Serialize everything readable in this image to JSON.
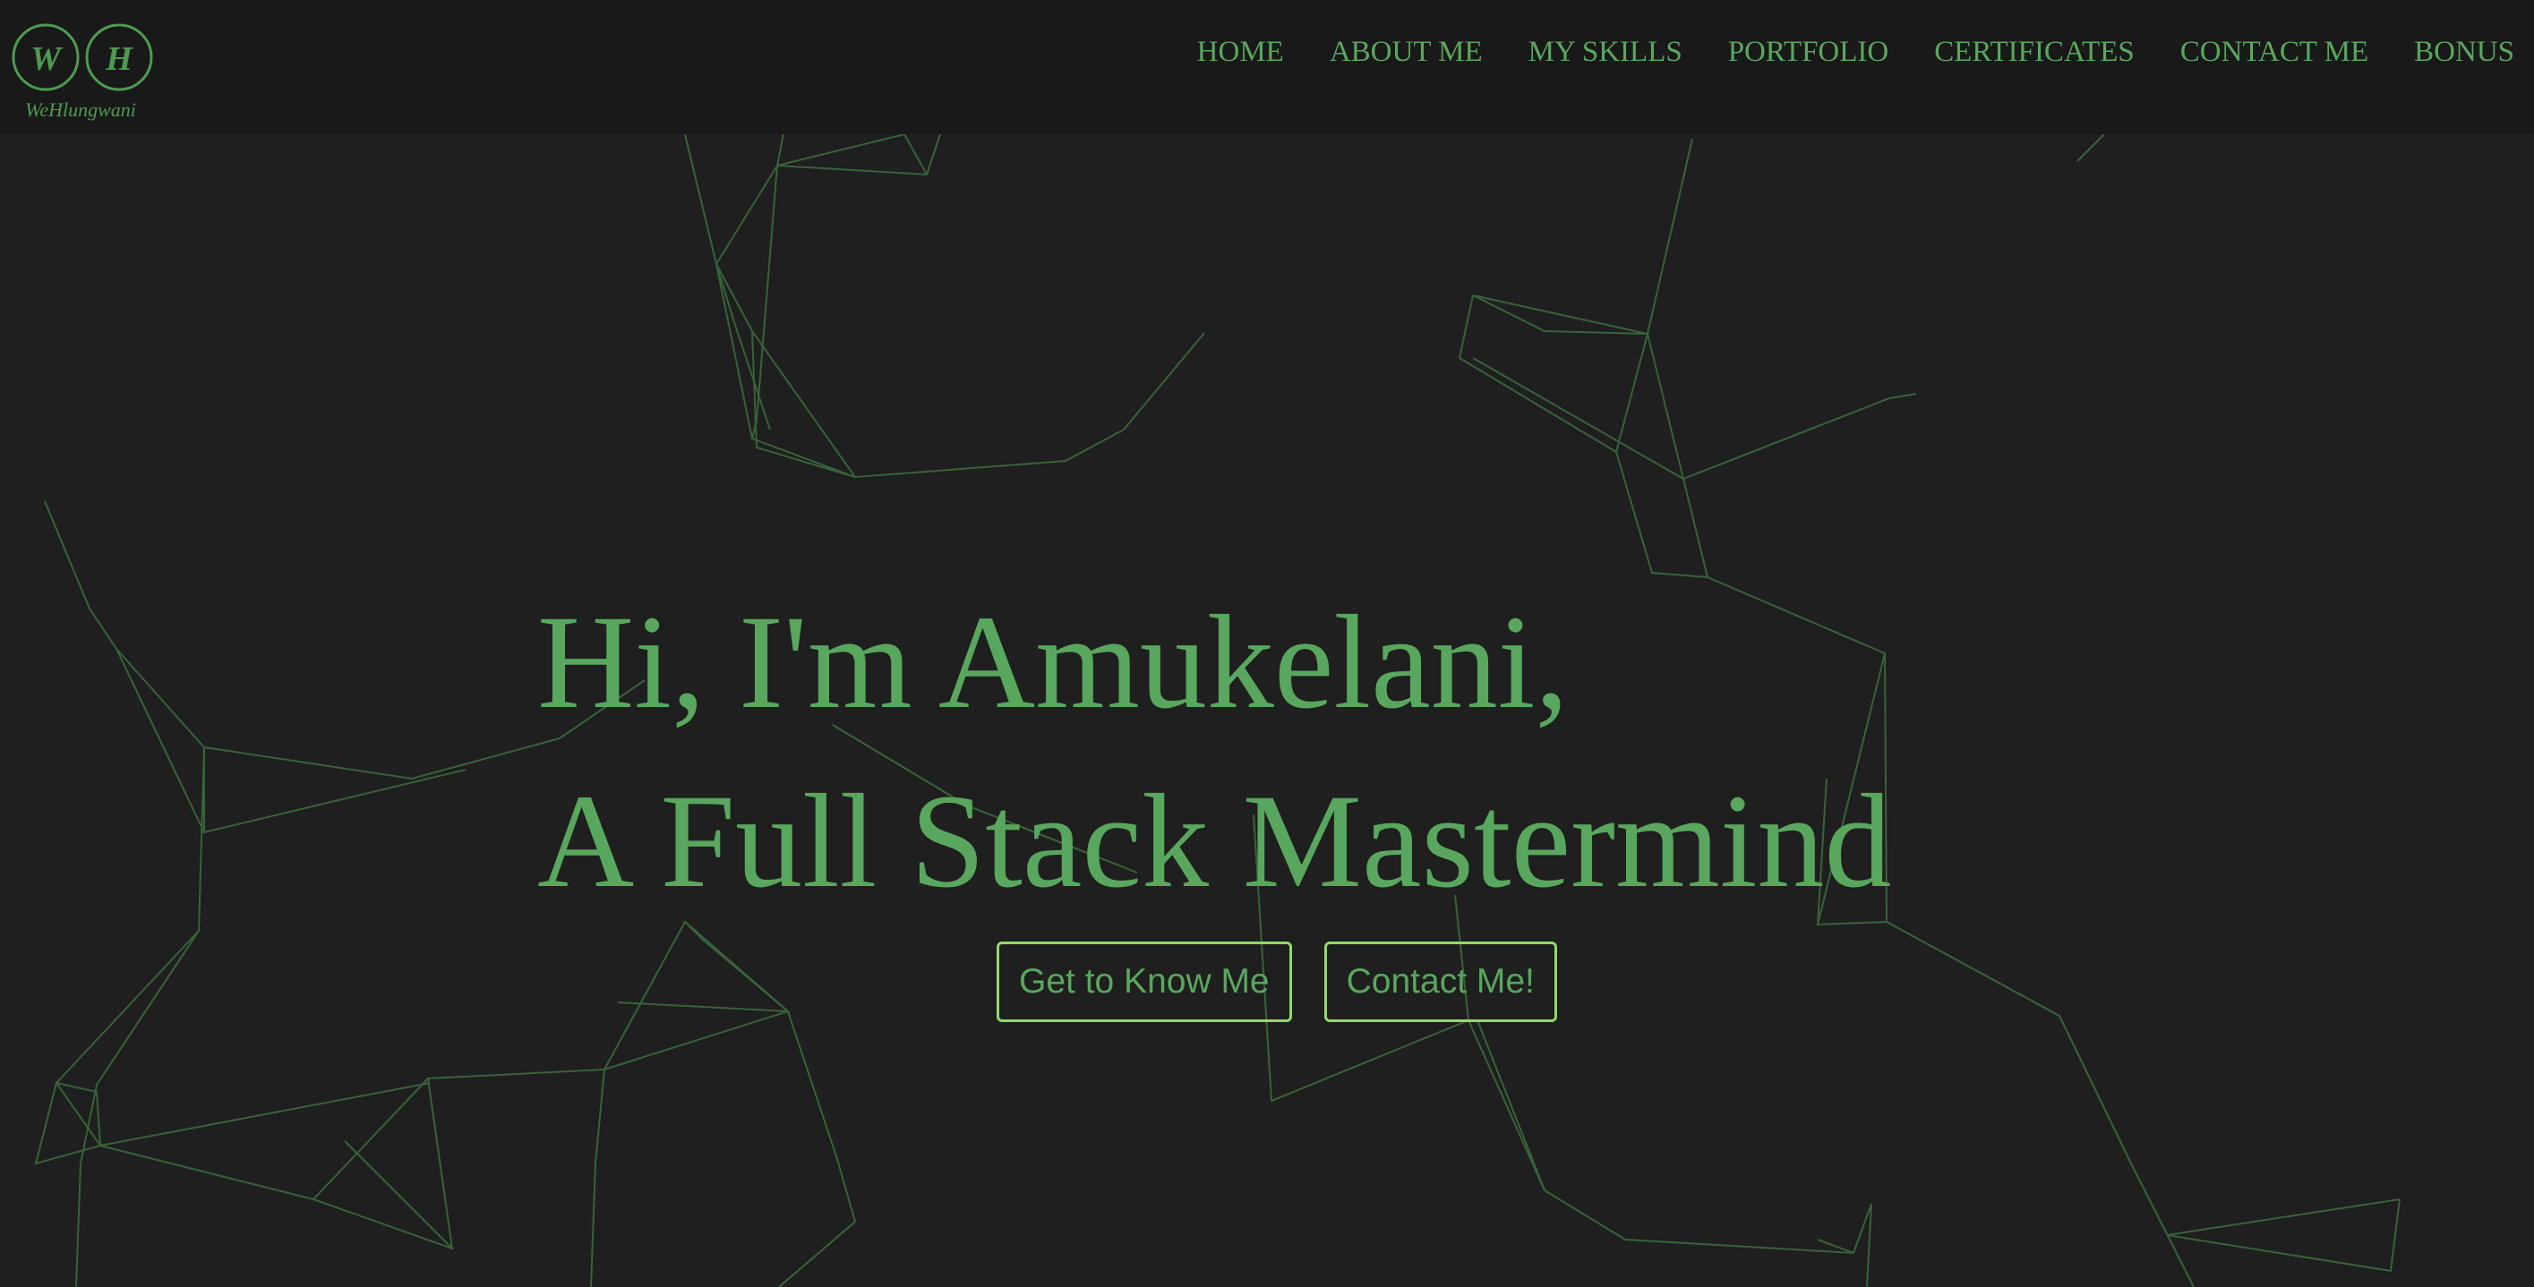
{
  "header": {
    "logo": {
      "initials": [
        "W",
        "H"
      ],
      "signature": "WeHlungwani"
    },
    "nav": [
      {
        "label": "HOME"
      },
      {
        "label": "ABOUT ME"
      },
      {
        "label": "MY SKILLS"
      },
      {
        "label": "PORTFOLIO"
      },
      {
        "label": "CERTIFICATES"
      },
      {
        "label": "CONTACT ME"
      },
      {
        "label": "BONUS"
      }
    ]
  },
  "hero": {
    "line1": "Hi, I'm Amukelani,",
    "line2": "A Full Stack Mastermind",
    "buttons": [
      {
        "label": "Get to Know Me"
      },
      {
        "label": "Contact Me!"
      }
    ]
  },
  "theme": {
    "background": "#1f1f1f",
    "navbar_background": "#191919",
    "accent_text": "#5aa75e",
    "button_border": "#8fdc63",
    "network_lines": "#4e9a52"
  }
}
